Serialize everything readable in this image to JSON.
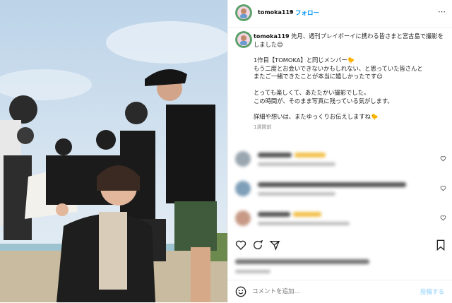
{
  "post": {
    "username": "tomoka119",
    "separator": "•",
    "follow_label": "フォロー",
    "caption_username": "tomoka119",
    "caption_line1": "先月、週刊プレイボーイに携わる皆さまと宮古島で撮影をしました😊",
    "caption_para2": "1作目【TOMOKA】と同じメンバー🐤\nもう二度とお会いできないかもしれない、と思っていた皆さんと\nまたご一緒できたことが本当に嬉しかったです😊",
    "caption_para3": "とっても楽しくて、あたたかい撮影でした。\nこの時間が、そのまま写真に残っている気がします。",
    "caption_para4": "詳細や想いは、またゆっくりお伝えしますね🐤",
    "time_ago": "1週間前"
  },
  "comment_bar": {
    "placeholder": "コメントを追加...",
    "post_label": "投稿する"
  },
  "colors": {
    "accent": "#0095f6",
    "post_button": "#b2dffc",
    "text": "#222222",
    "secondary": "#8e8e8e"
  },
  "icons": [
    "heart-icon",
    "comment-icon",
    "share-icon",
    "bookmark-icon",
    "emoji-icon"
  ]
}
